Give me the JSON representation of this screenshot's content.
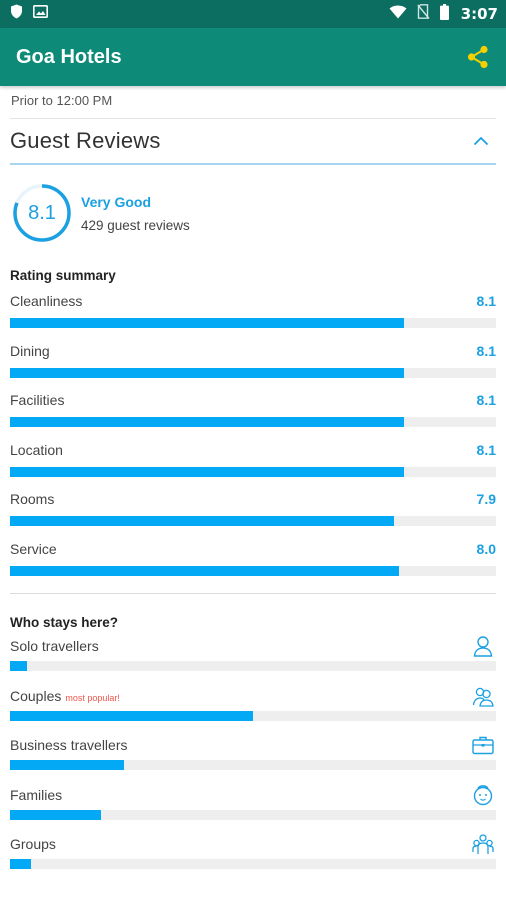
{
  "status_bar": {
    "time": "3:07",
    "left_icons": [
      "shield-icon",
      "image-icon"
    ],
    "right_icons": [
      "wifi-icon",
      "no-sim-icon",
      "battery-icon"
    ]
  },
  "app_bar": {
    "title": "Goa Hotels",
    "share_icon": "share-icon",
    "accent_color": "#f5d000"
  },
  "checkin": {
    "prior_text": "Prior to 12:00 PM"
  },
  "reviews": {
    "title": "Guest Reviews",
    "expanded": true,
    "score": "8.1",
    "score_fraction": 0.81,
    "verdict": "Very Good",
    "count_text": "429 guest reviews",
    "rating_summary_heading": "Rating summary",
    "ratings": [
      {
        "name": "Cleanliness",
        "score": "8.1",
        "value": 8.1
      },
      {
        "name": "Dining",
        "score": "8.1",
        "value": 8.1
      },
      {
        "name": "Facilities",
        "score": "8.1",
        "value": 8.1
      },
      {
        "name": "Location",
        "score": "8.1",
        "value": 8.1
      },
      {
        "name": "Rooms",
        "score": "7.9",
        "value": 7.9
      },
      {
        "name": "Service",
        "score": "8.0",
        "value": 8.0
      }
    ],
    "rating_max": 10
  },
  "who_stays": {
    "heading": "Who stays here?",
    "popular_label": "most popular!",
    "groups": [
      {
        "name": "Solo travellers",
        "share": 0.035,
        "icon": "person-icon",
        "popular": false
      },
      {
        "name": "Couples",
        "share": 0.5,
        "icon": "couple-icon",
        "popular": true
      },
      {
        "name": "Business travellers",
        "share": 0.235,
        "icon": "briefcase-icon",
        "popular": false
      },
      {
        "name": "Families",
        "share": 0.188,
        "icon": "family-icon",
        "popular": false
      },
      {
        "name": "Groups",
        "share": 0.044,
        "icon": "group-icon",
        "popular": false
      }
    ]
  },
  "colors": {
    "status_bar": "#0b6e60",
    "app_bar": "#0e8a78",
    "accent_blue": "#1ba0e2",
    "bar_fill": "#03a9f4",
    "bar_track": "#eeeeee",
    "popular_red": "#f0564b"
  }
}
